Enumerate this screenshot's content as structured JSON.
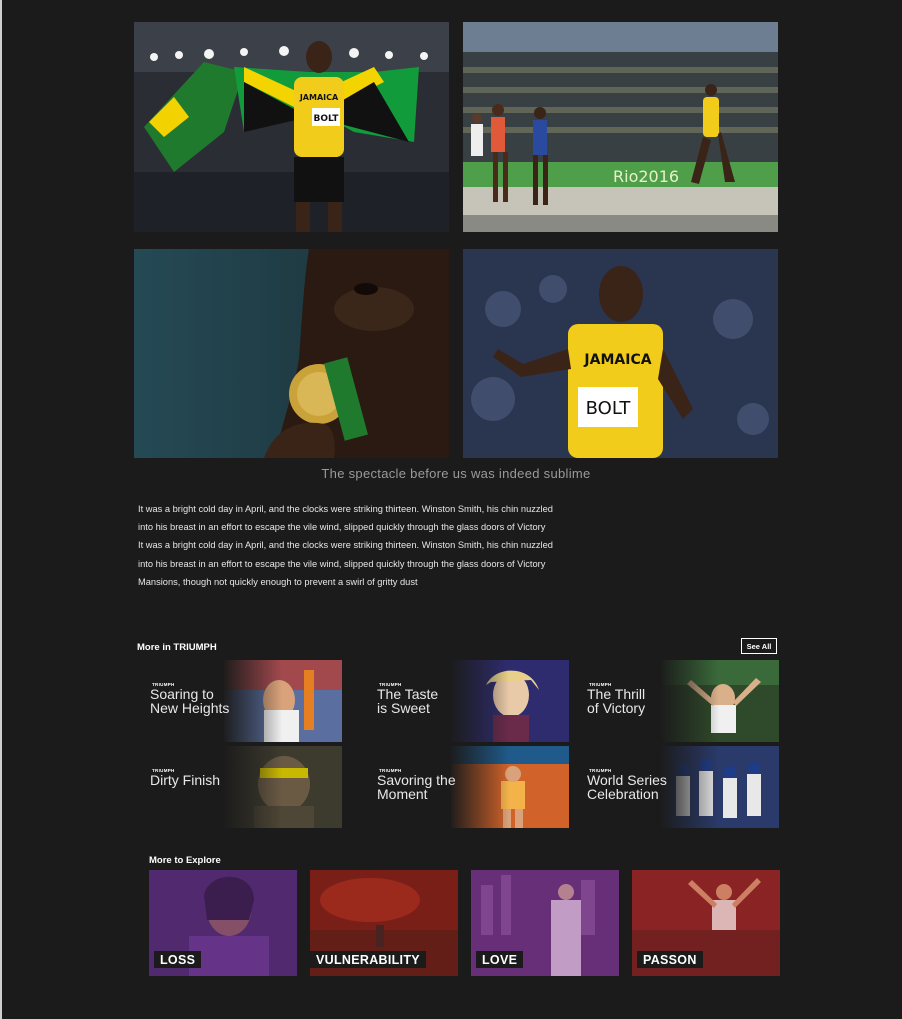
{
  "gallery": {
    "photos": [
      {
        "name": "bolt-with-flag-photo",
        "jersey_text": "JAMAICA",
        "bib_text": "BOLT"
      },
      {
        "name": "bolt-race-photo",
        "banner_text": "Rio2016"
      },
      {
        "name": "bolt-kissing-medal-photo"
      },
      {
        "name": "bolt-pointing-photo",
        "jersey_text": "JAMAICA",
        "bib_text": "BOLT"
      }
    ],
    "caption": "The spectacle before us was indeed sublime"
  },
  "article": {
    "paragraph_lines": [
      "It was a bright cold day in April, and the clocks were striking thirteen. Winston Smith, his chin nuzzled",
      "into his breast in an effort to escape the vile wind, slipped quickly through the glass doors of Victory",
      "It was a bright cold day in April, and the clocks were striking thirteen. Winston Smith, his chin nuzzled",
      "into his breast in an effort to escape the vile wind, slipped quickly through the glass doors of Victory",
      "Mansions, though not quickly enough to prevent a swirl of gritty dust"
    ]
  },
  "more_in": {
    "heading": "More in TRIUMPH",
    "see_all": "See All",
    "cards": [
      {
        "kicker": "TRIUMPH",
        "title_line1": "Soaring to",
        "title_line2": "New Heights"
      },
      {
        "kicker": "TRIUMPH",
        "title_line1": "The Taste",
        "title_line2": "is Sweet"
      },
      {
        "kicker": "TRIUMPH",
        "title_line1": "The Thrill",
        "title_line2": "of Victory"
      },
      {
        "kicker": "TRIUMPH",
        "title_line1": "Dirty Finish",
        "title_line2": ""
      },
      {
        "kicker": "TRIUMPH",
        "title_line1": "Savoring the",
        "title_line2": "Moment"
      },
      {
        "kicker": "TRIUMPH",
        "title_line1": "World Series",
        "title_line2": "Celebration"
      }
    ]
  },
  "explore": {
    "heading": "More to Explore",
    "tiles": [
      {
        "label": "LOSS",
        "tint": "#7a3ca0"
      },
      {
        "label": "VULNERABILITY",
        "tint": "#a02a22"
      },
      {
        "label": "LOVE",
        "tint": "#8a3a9a"
      },
      {
        "label": "PASSON",
        "tint": "#b03030"
      }
    ]
  }
}
